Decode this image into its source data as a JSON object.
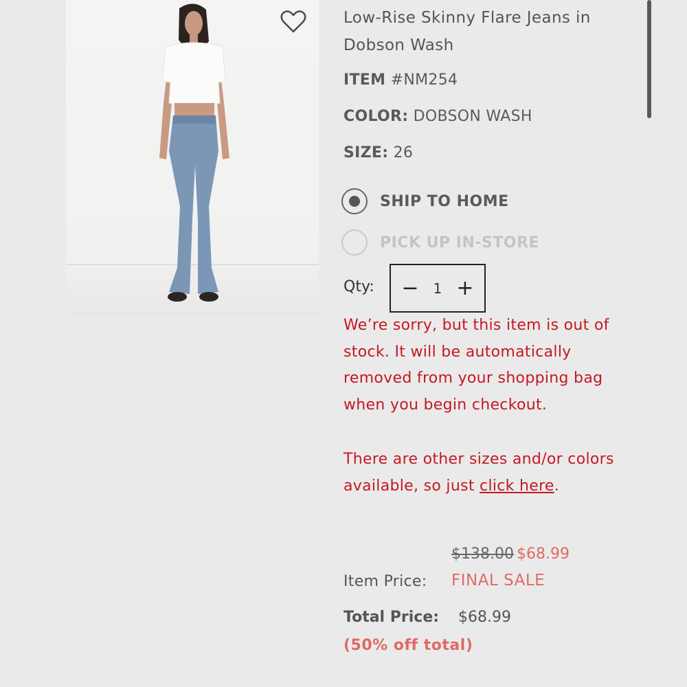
{
  "product": {
    "title": "Low-Rise Skinny Flare Jeans in Dobson Wash",
    "item_label": "ITEM",
    "item_number": "#NM254",
    "color_label": "COLOR:",
    "color_value": "DOBSON WASH",
    "size_label": "SIZE:",
    "size_value": "26",
    "image_alt": "model wearing flare jeans"
  },
  "fulfillment": {
    "options": [
      {
        "label": "SHIP TO HOME",
        "selected": true,
        "enabled": true
      },
      {
        "label": "PICK UP IN-STORE",
        "selected": false,
        "enabled": false
      }
    ]
  },
  "quantity": {
    "label": "Qty:",
    "value": "1",
    "minus": "−",
    "plus": "+"
  },
  "stock_message": {
    "line1": "We’re sorry, but this item is out of stock. It will be automatically removed from your shopping bag when you begin checkout.",
    "line2_prefix": "There are other sizes and/or colors available, so just ",
    "link_text": "click here",
    "line2_suffix": "."
  },
  "pricing": {
    "original_price": "$138.00",
    "sale_price": "$68.99",
    "item_price_label": "Item Price:",
    "sale_tag": "FINAL SALE",
    "total_label": "Total Price:",
    "total_value": "$68.99",
    "discount_note": "(50% off total)"
  },
  "colors": {
    "error": "#c4191f",
    "sale": "#e06a63",
    "background": "#ebeaeb"
  },
  "icons": {
    "favorite": "heart-outline-icon"
  }
}
